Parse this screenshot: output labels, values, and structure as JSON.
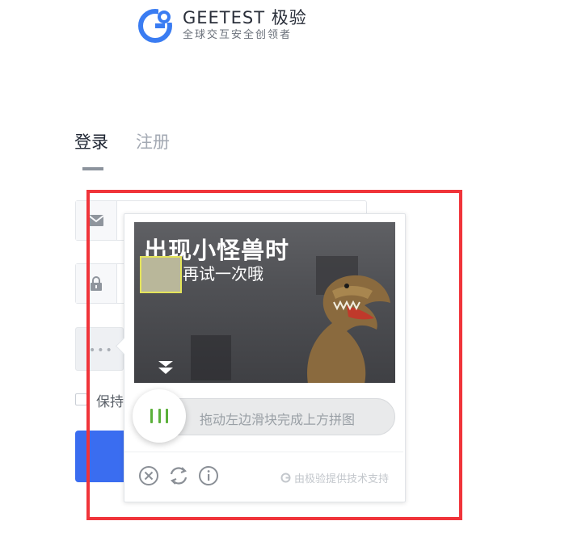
{
  "header": {
    "brand": "GEETEST 极验",
    "tagline": "全球交互安全创领者"
  },
  "tabs": [
    {
      "label": "登录",
      "active": true
    },
    {
      "label": "注册",
      "active": false
    }
  ],
  "form": {
    "remember_label": "保持"
  },
  "captcha": {
    "image_title": "出现小怪兽时",
    "image_subtitle": "再试一次哦",
    "slider_hint": "拖动左边滑块完成上方拼图",
    "powered_by": "由极验提供技术支持",
    "icons": [
      "close-icon",
      "refresh-icon",
      "info-icon"
    ]
  },
  "colors": {
    "highlight": "#f0343a",
    "brand_blue": "#3a6df0",
    "grip_green": "#5bb03a"
  }
}
